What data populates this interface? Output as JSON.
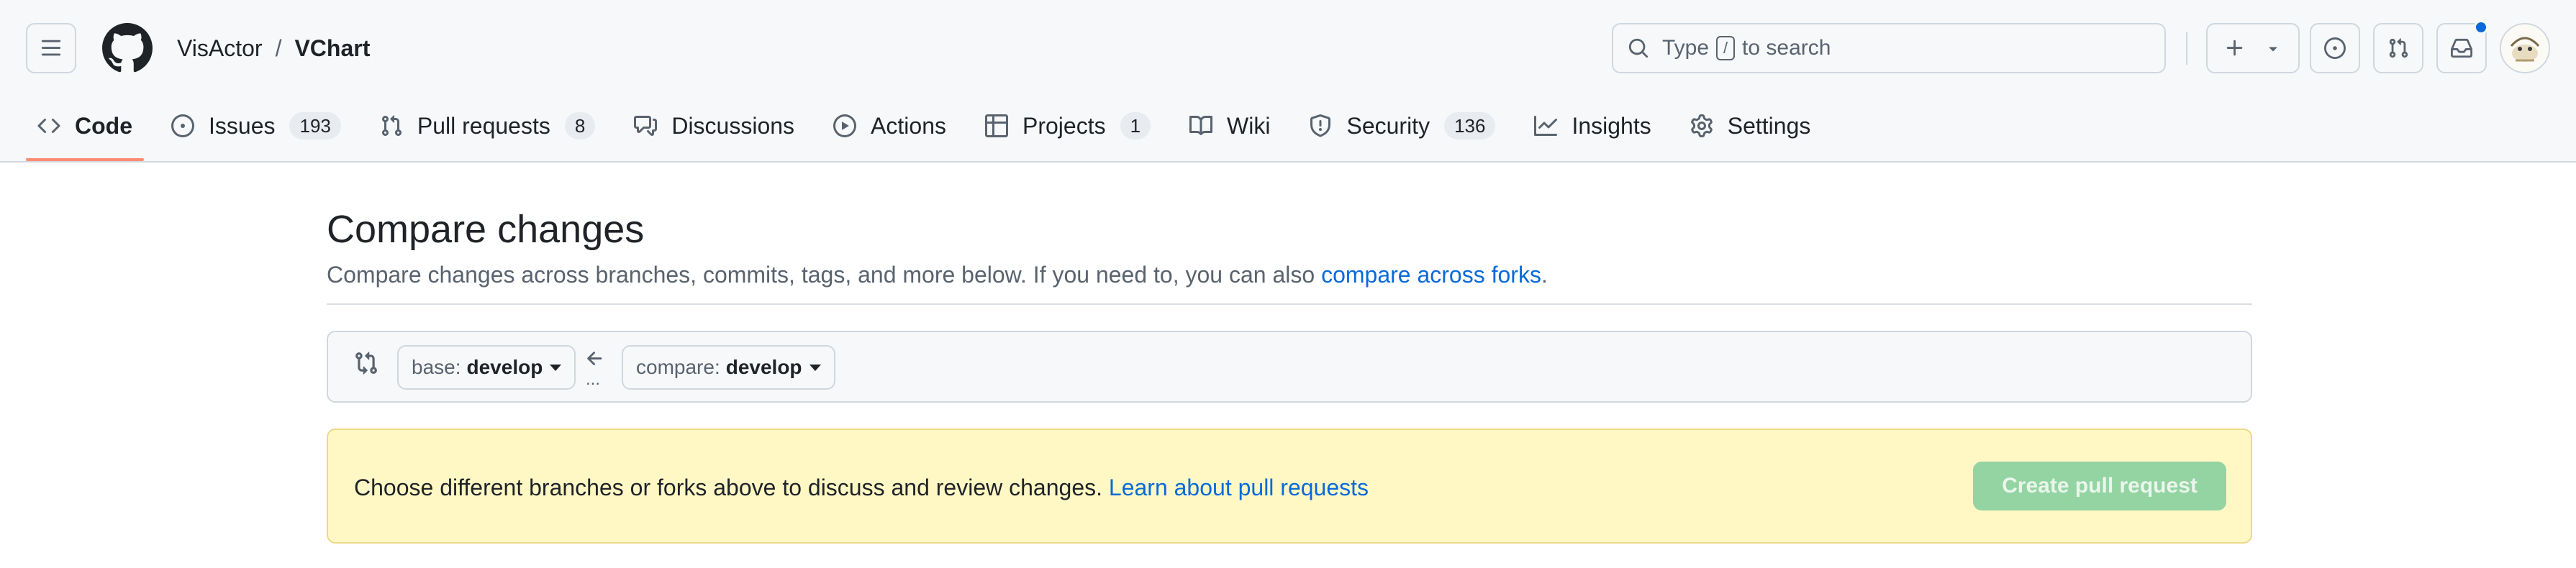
{
  "header": {
    "owner": "VisActor",
    "separator": "/",
    "repo": "VChart",
    "search": {
      "prefix": "Type",
      "key": "/",
      "suffix": "to search"
    },
    "icons": {
      "menu": "hamburger-icon",
      "logo": "github-mark-icon",
      "search": "search-icon",
      "new": "plus-icon",
      "issues": "issue-opened-icon",
      "pulls": "git-pull-request-icon",
      "inbox": "inbox-icon"
    },
    "notification_dot_color": "#0969da"
  },
  "tabs": [
    {
      "label": "Code",
      "icon": "code-icon",
      "counter": "",
      "selected": true
    },
    {
      "label": "Issues",
      "icon": "issue-opened-icon",
      "counter": "193"
    },
    {
      "label": "Pull requests",
      "icon": "git-pull-request-icon",
      "counter": "8"
    },
    {
      "label": "Discussions",
      "icon": "comment-discussion-icon",
      "counter": ""
    },
    {
      "label": "Actions",
      "icon": "play-icon",
      "counter": ""
    },
    {
      "label": "Projects",
      "icon": "table-icon",
      "counter": "1"
    },
    {
      "label": "Wiki",
      "icon": "book-icon",
      "counter": ""
    },
    {
      "label": "Security",
      "icon": "shield-icon",
      "counter": "136"
    },
    {
      "label": "Insights",
      "icon": "graph-icon",
      "counter": ""
    },
    {
      "label": "Settings",
      "icon": "gear-icon",
      "counter": ""
    }
  ],
  "compare": {
    "title": "Compare changes",
    "description": "Compare changes across branches, commits, tags, and more below. If you need to, you can also",
    "forks_link": "compare across forks",
    "period": ".",
    "base_label": "base:",
    "base_value": "develop",
    "compare_label": "compare:",
    "compare_value": "develop",
    "arrow_dots": "..."
  },
  "notice": {
    "text": "Choose different branches or forks above to discuss and review changes.",
    "link": "Learn about pull requests",
    "button": "Create pull request"
  },
  "colors": {
    "accent_link": "#0969da",
    "selected_tab_underline": "#fd8c73",
    "notice_bg": "#fff8c5",
    "create_button_disabled": "#94d3a2"
  }
}
